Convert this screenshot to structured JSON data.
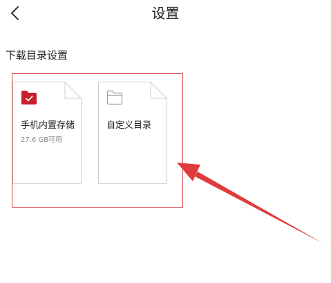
{
  "header": {
    "title": "设置",
    "back_icon": "chevron-left-icon"
  },
  "section": {
    "title": "下载目录设置"
  },
  "cards": [
    {
      "name": "手机内置存储",
      "sub": "27.6 GB可用",
      "icon": "folder-check-icon",
      "selected": true
    },
    {
      "name": "自定义目录",
      "sub": "",
      "icon": "folder-outline-icon",
      "selected": false
    }
  ],
  "colors": {
    "accent": "#c8202a",
    "annotation": "#d93a3a"
  }
}
